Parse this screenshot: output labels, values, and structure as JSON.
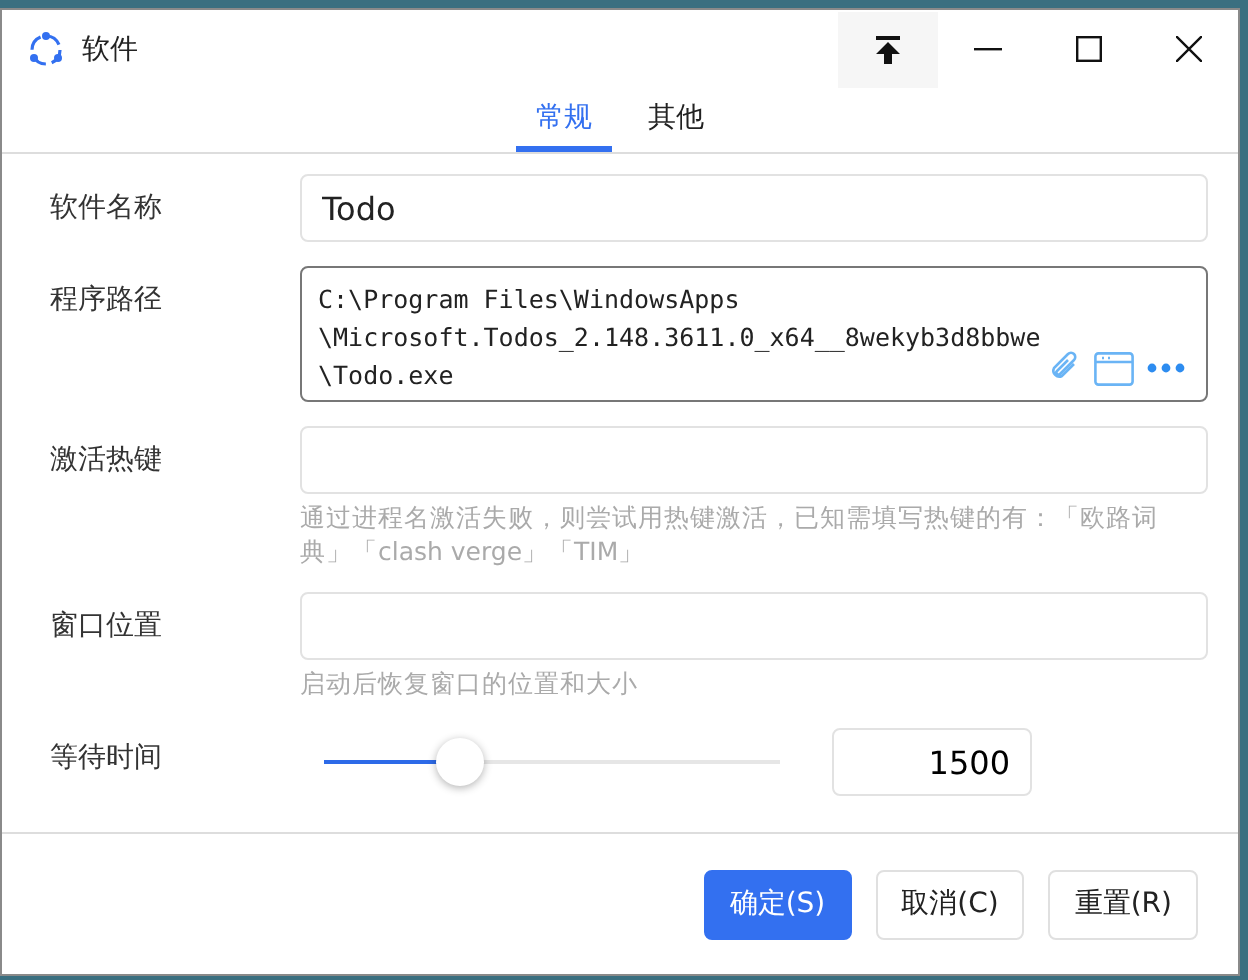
{
  "window": {
    "title": "软件"
  },
  "tabs": [
    {
      "label": "常规",
      "selected": true
    },
    {
      "label": "其他",
      "selected": false
    }
  ],
  "fields": [
    {
      "kind": "text",
      "label": "软件名称",
      "value": "Todo"
    },
    {
      "kind": "path",
      "label": "程序路径",
      "lines": [
        "C:\\Program Files\\WindowsApps",
        "\\Microsoft.Todos_2.148.3611.0_x64__8wekyb3d8bbwe",
        "\\Todo.exe"
      ]
    },
    {
      "kind": "text",
      "label": "激活热键",
      "hint": "通过进程名激活失败，则尝试用热键激活，已知需填写热键的有：「欧路词典」「clash verge」「TIM」"
    },
    {
      "kind": "text",
      "label": "窗口位置",
      "hint": "启动后恢复窗口的位置和大小"
    },
    {
      "kind": "slider",
      "label": "等待时间",
      "level": 0.3,
      "value": "1500"
    }
  ],
  "buttons": [
    {
      "label": "确定(S)",
      "primary": true
    },
    {
      "label": "取消(C)",
      "primary": false
    },
    {
      "label": "重置(R)",
      "primary": false
    }
  ]
}
